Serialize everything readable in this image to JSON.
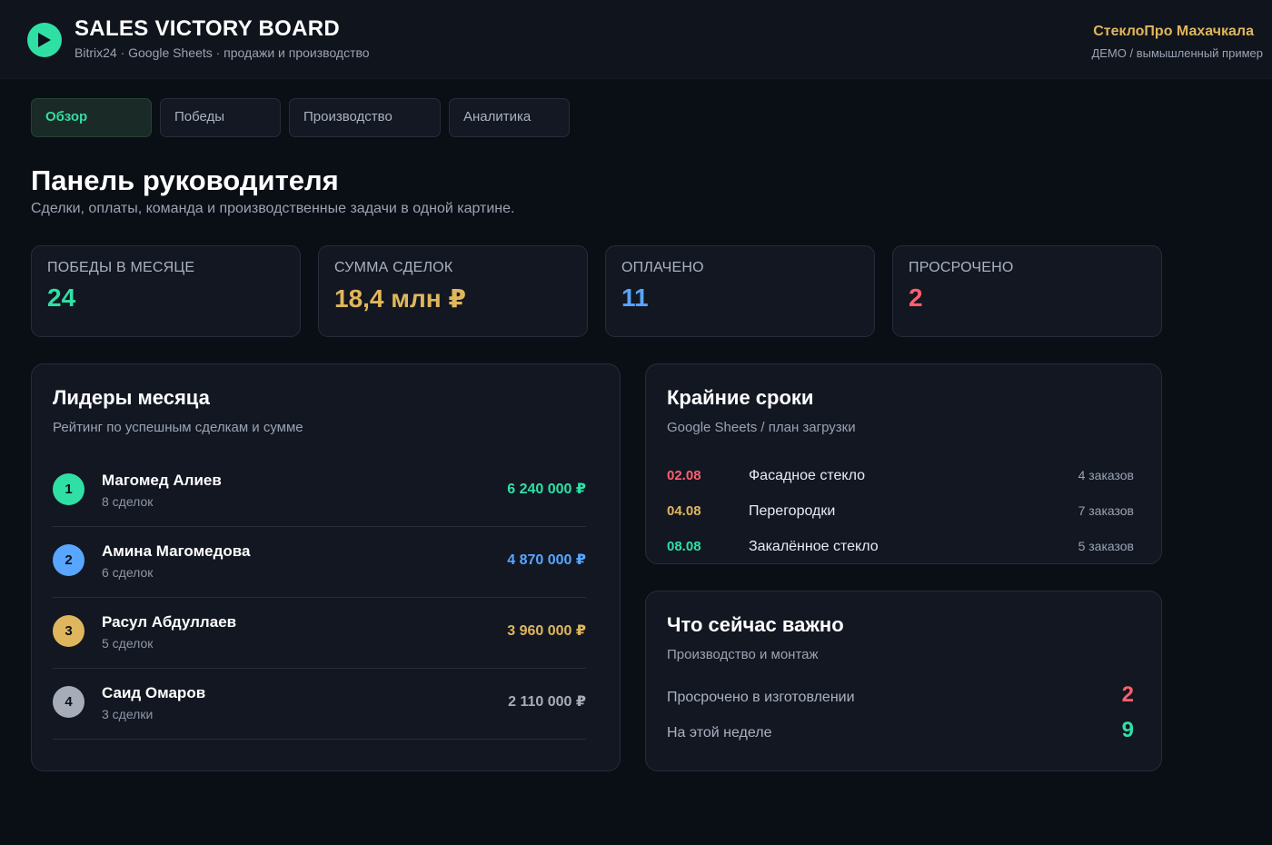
{
  "colors": {
    "green": "#2fe0a5",
    "gold": "#e0b65c",
    "blue": "#58a6ff",
    "red": "#ff5f6d",
    "gray": "#a6adb9"
  },
  "header": {
    "logo_icon": "play-icon",
    "title": "SALES VICTORY BOARD",
    "subtitle": "Bitrix24 · Google Sheets · продажи и производство",
    "company": "СтеклоПро Махачкала",
    "company_note": "ДЕМО / вымышленный пример"
  },
  "tabs": [
    {
      "label": "Обзор",
      "active": true
    },
    {
      "label": "Победы",
      "active": false
    },
    {
      "label": "Производство",
      "active": false
    },
    {
      "label": "Аналитика",
      "active": false
    }
  ],
  "page": {
    "title": "Панель руководителя",
    "subtitle": "Сделки, оплаты, команда и производственные задачи в одной картине."
  },
  "kpis": [
    {
      "label": "ПОБЕДЫ В МЕСЯЦЕ",
      "value": "24",
      "color": "#2fe0a5"
    },
    {
      "label": "СУММА СДЕЛОК",
      "value": "18,4 млн ₽",
      "color": "#e0b65c"
    },
    {
      "label": "ОПЛАЧЕНО",
      "value": "11",
      "color": "#58a6ff"
    },
    {
      "label": "ПРОСРОЧЕНО",
      "value": "2",
      "color": "#ff5f6d"
    }
  ],
  "leaders": {
    "title": "Лидеры месяца",
    "subtitle": "Рейтинг по успешным сделкам и сумме",
    "items": [
      {
        "rank": "1",
        "name": "Магомед Алиев",
        "deals": "8 сделок",
        "sum": "6 240 000 ₽",
        "color": "#2fe0a5"
      },
      {
        "rank": "2",
        "name": "Амина Магомедова",
        "deals": "6 сделок",
        "sum": "4 870 000 ₽",
        "color": "#58a6ff"
      },
      {
        "rank": "3",
        "name": "Расул Абдуллаев",
        "deals": "5 сделок",
        "sum": "3 960 000 ₽",
        "color": "#e0b65c"
      },
      {
        "rank": "4",
        "name": "Саид Омаров",
        "deals": "3 сделки",
        "sum": "2 110 000 ₽",
        "color": "#a6adb9"
      }
    ]
  },
  "deadlines": {
    "title": "Крайние сроки",
    "subtitle": "Google Sheets / план загрузки",
    "items": [
      {
        "date": "02.08",
        "name": "Фасадное стекло",
        "count": "4 заказов",
        "color": "#ff5f6d"
      },
      {
        "date": "04.08",
        "name": "Перегородки",
        "count": "7 заказов",
        "color": "#e0b65c"
      },
      {
        "date": "08.08",
        "name": "Закалённое стекло",
        "count": "5 заказов",
        "color": "#2fe0a5"
      }
    ]
  },
  "important": {
    "title": "Что сейчас важно",
    "subtitle": "Производство и монтаж",
    "items": [
      {
        "label": "Просрочено в изготовлении",
        "value": "2",
        "color": "#ff5f6d"
      },
      {
        "label": "На этой неделе",
        "value": "9",
        "color": "#2fe0a5"
      }
    ]
  }
}
